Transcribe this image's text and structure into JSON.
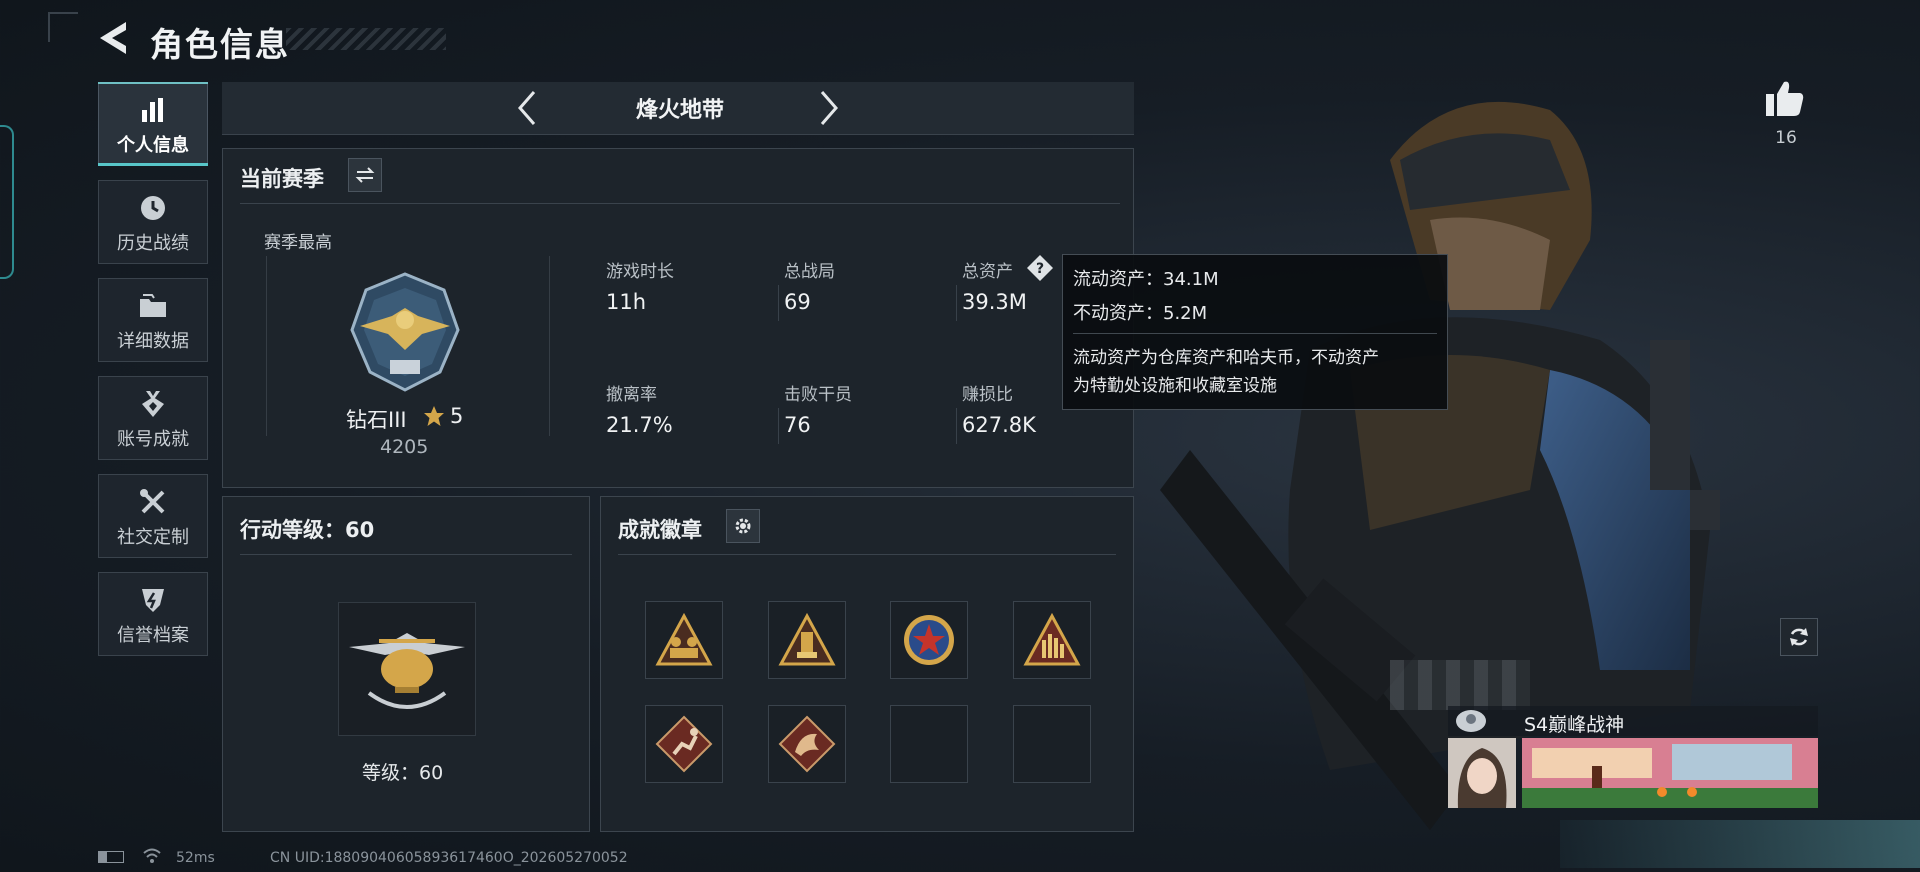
{
  "header": {
    "title": "角色信息"
  },
  "sidebar": {
    "items": [
      {
        "label": "个人信息",
        "icon": "bar-chart-icon",
        "active": true
      },
      {
        "label": "历史战绩",
        "icon": "clock-icon"
      },
      {
        "label": "详细数据",
        "icon": "folder-icon"
      },
      {
        "label": "账号成就",
        "icon": "achievement-icon"
      },
      {
        "label": "社交定制",
        "icon": "wrench-screwdriver-icon"
      },
      {
        "label": "信誉档案",
        "icon": "shield-icon"
      }
    ]
  },
  "mode": {
    "label": "烽火地带"
  },
  "season": {
    "title": "当前赛季",
    "best_label": "赛季最高",
    "rank_name": "钻石III",
    "rank_stars": "5",
    "rank_points": "4205",
    "stats": [
      {
        "label": "游戏时长",
        "value": "11h"
      },
      {
        "label": "总战局",
        "value": "69"
      },
      {
        "label": "总资产",
        "value": "39.3M"
      },
      {
        "label": "撤离率",
        "value": "21.7%"
      },
      {
        "label": "击败干员",
        "value": "76"
      },
      {
        "label": "赚损比",
        "value": "627.8K"
      }
    ]
  },
  "tooltip": {
    "liquid": "流动资产：34.1M",
    "fixed": "不动资产：5.2M",
    "desc1": "流动资产为仓库资产和哈夫币，不动资产",
    "desc2": "为特勤处设施和收藏室设施"
  },
  "action_level": {
    "title": "行动等级：60",
    "level_text": "等级：60"
  },
  "achievements": {
    "title": "成就徽章",
    "filled_count": 6,
    "total_slots": 8
  },
  "likes": {
    "count": "16"
  },
  "stream": {
    "title": "S4巅峰战神"
  },
  "footer": {
    "ping": "52ms",
    "uid": "CN UID:18809040605893617460O_202605270052"
  },
  "colors": {
    "accent": "#58c6c9",
    "gold": "#d4a64a",
    "panel": "#1d242b"
  }
}
